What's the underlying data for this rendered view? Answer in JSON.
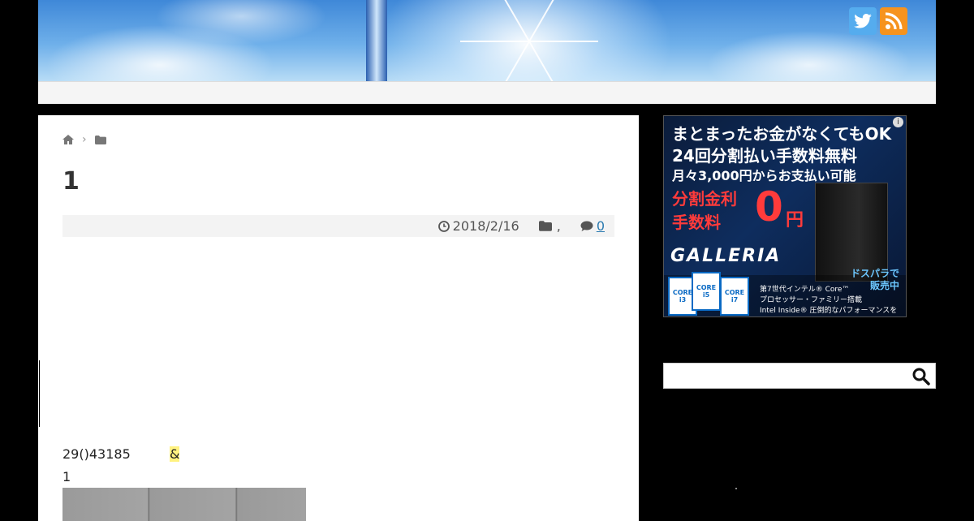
{
  "header": {
    "social": {
      "twitter_icon": "twitter-bird-icon",
      "rss_icon": "rss-feed-icon",
      "twitter_color": "#55acee",
      "rss_color": "#f6931e"
    }
  },
  "breadcrumb": {
    "home_icon": "home-icon",
    "separator": "›",
    "category_icon": "folder-icon"
  },
  "post": {
    "title": "1",
    "date": "2018/2/16",
    "category_separator": ",",
    "comment_count": "0",
    "body_line_1": "29()43185",
    "body_highlight": "&",
    "body_line_2": "1"
  },
  "sidebar": {
    "ad": {
      "line1": "まとまったお金がなくてもOK",
      "line2": "24回分割払い手数料無料",
      "line3": "月々3,000円からお支払い可能",
      "red_line1": "分割金利",
      "red_line2": "手数料",
      "zero": "0",
      "yen": "円",
      "brand": "GALLERIA",
      "sale_line1": "ドスパラで",
      "sale_line2": "販売中",
      "fine1": "第7世代インテル® Core™",
      "fine2": "プロセッサー・ファミリー搭載",
      "fine3": "Intel Inside® 圧倒的なパフォーマンスを",
      "chip1": "CORE i3",
      "chip2": "CORE i5",
      "chip3": "CORE i7",
      "info": "i"
    },
    "search": {
      "placeholder": "",
      "icon": "search-icon"
    }
  }
}
